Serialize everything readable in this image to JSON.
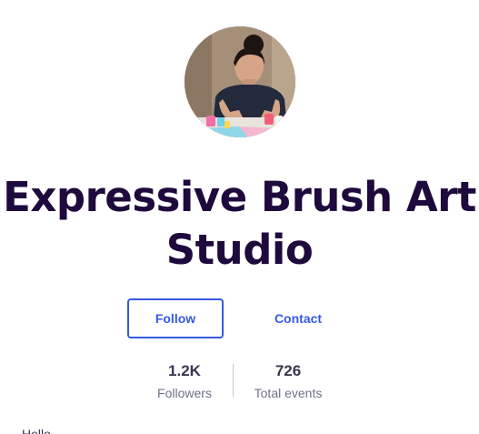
{
  "organizer": {
    "avatar_alt": "avatar",
    "title": "Expressive Brush Art Studio"
  },
  "actions": {
    "follow_label": "Follow",
    "contact_label": "Contact"
  },
  "stats": {
    "followers_value": "1.2K",
    "followers_label": "Followers",
    "events_value": "726",
    "events_label": "Total events"
  },
  "about": {
    "text": "Hello"
  },
  "colors": {
    "title": "#1e0a3c",
    "accent": "#3659e3",
    "muted": "#6f7287"
  }
}
